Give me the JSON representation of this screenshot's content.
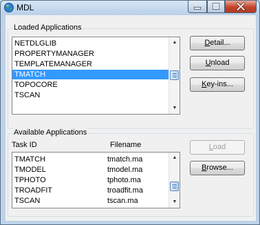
{
  "window": {
    "title": "MDL"
  },
  "loaded": {
    "label": "Loaded Applications",
    "items": [
      {
        "name": "NETDLGLIB",
        "selected": false
      },
      {
        "name": "PROPERTYMANAGER",
        "selected": false
      },
      {
        "name": "TEMPLATEMANAGER",
        "selected": false
      },
      {
        "name": "TMATCH",
        "selected": true
      },
      {
        "name": "TOPOCORE",
        "selected": false
      },
      {
        "name": "TSCAN",
        "selected": false
      }
    ]
  },
  "buttons": {
    "detail": {
      "pre": "",
      "key": "D",
      "post": "etail..."
    },
    "unload": {
      "pre": "",
      "key": "U",
      "post": "nload"
    },
    "keyins": {
      "pre": "",
      "key": "K",
      "post": "ey-ins..."
    },
    "load": {
      "pre": "",
      "key": "L",
      "post": "oad",
      "enabled": false
    },
    "browse": {
      "pre": "",
      "key": "B",
      "post": "rowse..."
    }
  },
  "available": {
    "label": "Available Applications",
    "columns": {
      "task": "Task ID",
      "file": "Filename"
    },
    "rows": [
      {
        "task": "TMATCH",
        "file": "tmatch.ma"
      },
      {
        "task": "TMODEL",
        "file": "tmodel.ma"
      },
      {
        "task": "TPHOTO",
        "file": "tphoto.ma"
      },
      {
        "task": "TROADFIT",
        "file": "troadfit.ma"
      },
      {
        "task": "TSCAN",
        "file": "tscan.ma"
      }
    ]
  },
  "colors": {
    "selection": "#3399ff",
    "close_button": "#c3432a",
    "title_bar": "#bcd3ea"
  },
  "icons": {
    "app": "globe-icon",
    "minimize": "minimize-icon",
    "maximize": "maximize-icon",
    "close": "close-icon"
  }
}
